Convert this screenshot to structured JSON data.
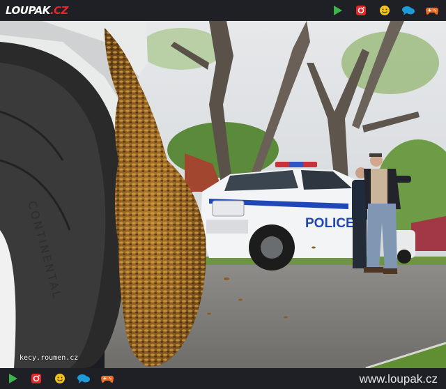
{
  "header": {
    "logo_main": "LOUPAK",
    "logo_suffix": ".CZ",
    "icons": [
      "play-icon",
      "instagram-icon",
      "smiley-icon",
      "chat-icon",
      "gamepad-icon"
    ]
  },
  "photo": {
    "car_door_text": "POLICE",
    "watermark": "kecy.roumen.cz"
  },
  "footer": {
    "icons": [
      "play-icon",
      "instagram-icon",
      "smiley-icon",
      "chat-icon",
      "gamepad-icon"
    ],
    "site_url": "www.loupak.cz"
  },
  "colors": {
    "bar_background": "#1e2026",
    "brand_red": "#e8262a",
    "play_green": "#3ab54a",
    "smiley_yellow": "#f4c21b",
    "chat_blue": "#1d9bd8",
    "gamepad_orange": "#f26b21"
  }
}
